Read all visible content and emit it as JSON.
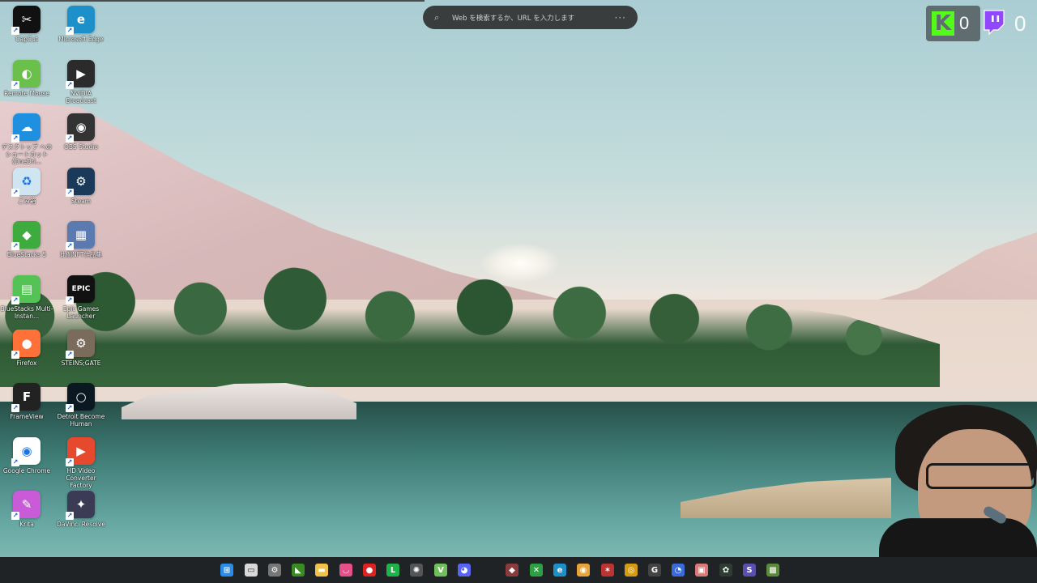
{
  "browser": {
    "search_placeholder": "Web を検索するか、URL を入力します",
    "more_glyph": "···",
    "search_glyph": "⌕"
  },
  "overlays": {
    "kick_count": "0",
    "twitch_count": "0",
    "kick_color": "#53fc18",
    "twitch_color": "#9146ff"
  },
  "desktop_icons": [
    {
      "label": "CapCut",
      "icon": "capcut-icon"
    },
    {
      "label": "Microsoft Edge",
      "icon": "edge-icon"
    },
    {
      "label": "Remote Mouse",
      "icon": "remote-mouse-icon"
    },
    {
      "label": "NVIDIA Broadcast",
      "icon": "nvidia-broadcast-icon"
    },
    {
      "label": "デスクトップ ヘのショートカット (OneDri...",
      "icon": "onedrive-icon"
    },
    {
      "label": "OBS Studio",
      "icon": "obs-icon"
    },
    {
      "label": "ごみ箱",
      "icon": "recycle-bin-icon"
    },
    {
      "label": "Steam",
      "icon": "steam-icon"
    },
    {
      "label": "BlueStacks 5",
      "icon": "bluestacks-icon"
    },
    {
      "label": "比例NFT作品集",
      "icon": "nft-collection-icon"
    },
    {
      "label": "BlueStacks Multi-Instan...",
      "icon": "bluestacks-multi-icon"
    },
    {
      "label": "Epic Games Launcher",
      "icon": "epic-games-icon"
    },
    {
      "label": "Firefox",
      "icon": "firefox-icon"
    },
    {
      "label": "STEINS;GATE",
      "icon": "steins-gate-icon"
    },
    {
      "label": "FrameView",
      "icon": "frameview-icon"
    },
    {
      "label": "Detroit Become Human",
      "icon": "detroit-icon"
    },
    {
      "label": "Google Chrome",
      "icon": "chrome-icon"
    },
    {
      "label": "HD Video Converter Factory",
      "icon": "hd-video-converter-icon"
    },
    {
      "label": "Krita",
      "icon": "krita-icon"
    },
    {
      "label": "DaVinci Resolve",
      "icon": "davinci-resolve-icon"
    }
  ],
  "taskbar": {
    "left_items": [
      "start-icon",
      "task-view-icon",
      "settings-icon",
      "nvidia-icon",
      "file-explorer-icon",
      "lips-app-icon",
      "record-icon",
      "line-icon",
      "chatgpt-icon",
      "vim-icon",
      "discord-icon"
    ],
    "right_items": [
      "tray-app-icon",
      "xbox-icon",
      "edge-icon",
      "chrome-icon",
      "game-icon",
      "coin-icon",
      "g-app-icon",
      "browser-icon",
      "photo-icon",
      "tray-icon",
      "mail-icon",
      "minecraft-icon"
    ]
  }
}
